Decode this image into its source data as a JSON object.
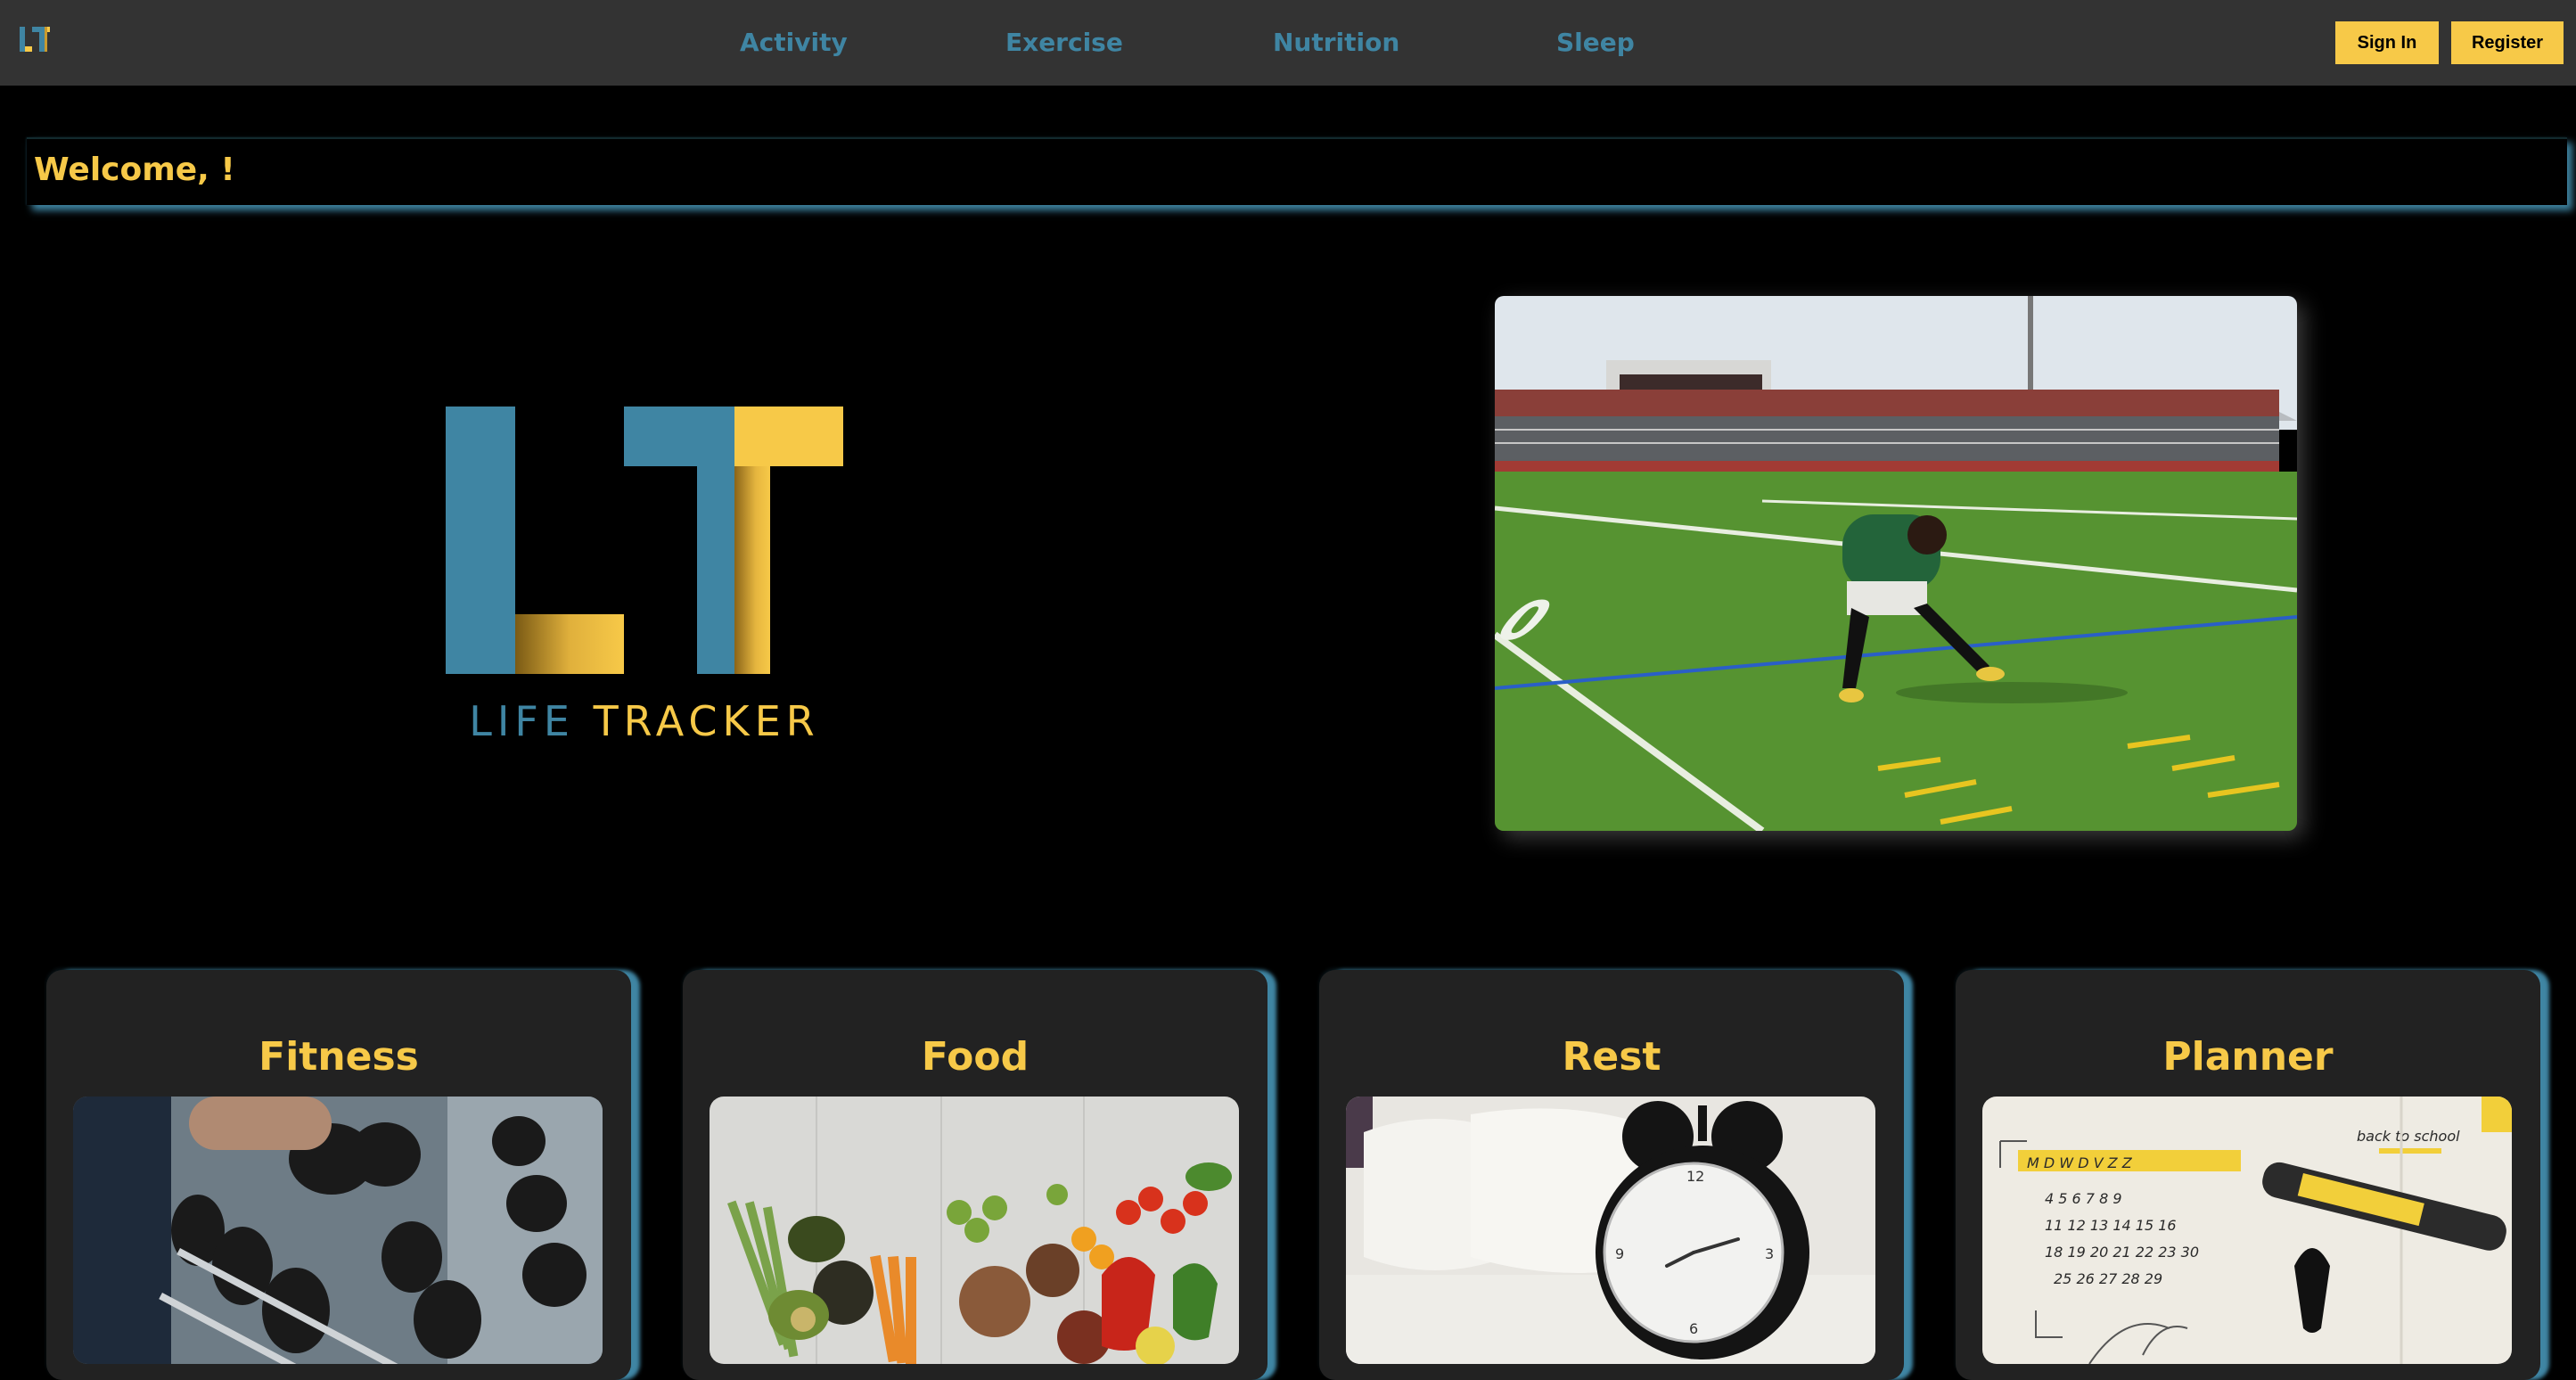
{
  "app": {
    "logo_text": "LT",
    "colors": {
      "accent_blue": "#3f85a3",
      "accent_yellow": "#f7c948",
      "nav_bg": "#333333",
      "card_bg": "#222222"
    }
  },
  "nav": {
    "links": [
      {
        "label": "Activity"
      },
      {
        "label": "Exercise"
      },
      {
        "label": "Nutrition"
      },
      {
        "label": "Sleep"
      }
    ],
    "sign_in_label": "Sign In",
    "register_label": "Register"
  },
  "welcome": {
    "text": "Welcome, !"
  },
  "hero": {
    "logo_word_1": "LIFE",
    "logo_word_2": "TRACKER",
    "photo_icon": "athlete-on-field-photo"
  },
  "cards": [
    {
      "title": "Fitness",
      "image_icon": "dumbbells-photo"
    },
    {
      "title": "Food",
      "image_icon": "vegetables-photo"
    },
    {
      "title": "Rest",
      "image_icon": "alarm-clock-photo"
    },
    {
      "title": "Planner",
      "image_icon": "calendar-planner-photo"
    }
  ]
}
